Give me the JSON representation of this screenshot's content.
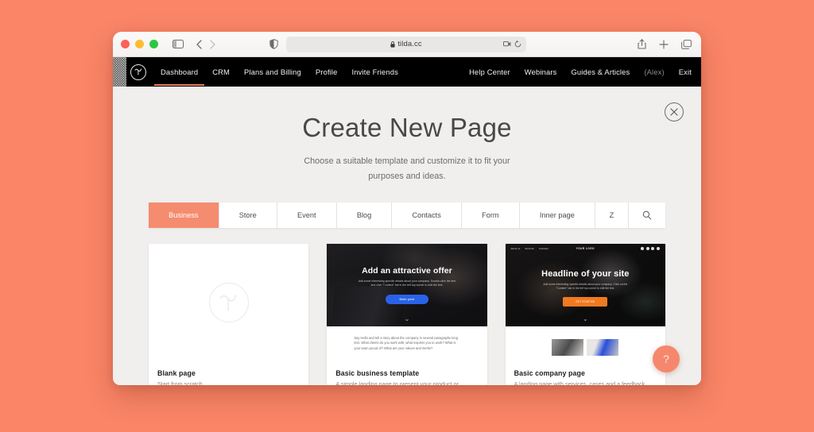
{
  "browser": {
    "url": "tilda.cc",
    "lock_icon": "lock-icon",
    "traffic_lights": [
      "close-red",
      "minimize-yellow",
      "zoom-green"
    ],
    "toolbar_icons": [
      "sidebar-toggle-icon",
      "back-arrow-icon",
      "forward-arrow-icon",
      "reader-shield-icon",
      "extensions-icon",
      "reload-icon",
      "share-icon",
      "new-tab-icon",
      "tab-overview-icon"
    ]
  },
  "nav": {
    "logo": "tilda-logo",
    "left_links": [
      {
        "label": "Dashboard",
        "active": true
      },
      {
        "label": "CRM",
        "active": false
      },
      {
        "label": "Plans and Billing",
        "active": false
      },
      {
        "label": "Profile",
        "active": false
      },
      {
        "label": "Invite Friends",
        "active": false
      }
    ],
    "right_links": [
      {
        "label": "Help Center",
        "dim": false
      },
      {
        "label": "Webinars",
        "dim": false
      },
      {
        "label": "Guides & Articles",
        "dim": false
      },
      {
        "label": "(Alex)",
        "dim": true
      },
      {
        "label": "Exit",
        "dim": false
      }
    ]
  },
  "page": {
    "title": "Create New Page",
    "subtitle": "Choose a suitable template and customize it to fit your purposes and ideas.",
    "close_icon": "close-icon",
    "help_label": "?"
  },
  "tabs": [
    {
      "label": "Business",
      "active": true
    },
    {
      "label": "Store",
      "active": false
    },
    {
      "label": "Event",
      "active": false
    },
    {
      "label": "Blog",
      "active": false
    },
    {
      "label": "Contacts",
      "active": false
    },
    {
      "label": "Form",
      "active": false
    },
    {
      "label": "Inner page",
      "active": false
    },
    {
      "label": "Z",
      "active": false,
      "narrow": true
    },
    {
      "label": "search-icon",
      "active": false,
      "search": true
    }
  ],
  "templates": [
    {
      "name": "Blank page",
      "desc": "Start from scratch",
      "kind": "blank"
    },
    {
      "name": "Basic business template",
      "desc": "A simple landing page to present your product or service",
      "kind": "hero",
      "hero_title": "Add an attractive offer",
      "hero_sub": "Add some interesting specific details about your company. Double-click the text and click \"Content\" tab in the left top corner to edit the text.",
      "hero_button": "Make great",
      "body_text": "Say Hello and tell a story about the company in several paragraphs long text. What clients do you work with, what inspires you to work? What is your team proud of? What are your values and merits?"
    },
    {
      "name": "Basic company page",
      "desc": "A landing page with services, cases and a feedback form",
      "kind": "hero-nav",
      "mini_logo": "YOUR LOGO",
      "mini_links": [
        "About us",
        "Services",
        "Contacts"
      ],
      "hero_title": "Headline of your site",
      "hero_sub": "Add some interesting specific details about your company. Click on the \"Content\" tab in the left top corner to edit the text.",
      "hero_button": "GET STARTED"
    }
  ],
  "colors": {
    "page_background": "#fa8567",
    "accent": "#f58b6f",
    "nav_background": "#000000",
    "content_background": "#f0efee"
  }
}
